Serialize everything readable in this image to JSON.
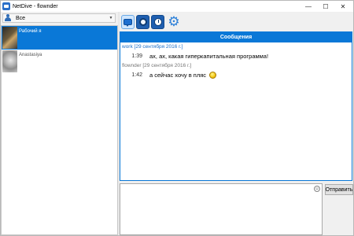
{
  "window": {
    "title": "NetDive - flownder",
    "controls": [
      "—",
      "☐",
      "✕"
    ]
  },
  "contacts": {
    "filter_label": "Все",
    "filter_icon": "users-icon",
    "items": [
      {
        "name": "Рабочий я",
        "selected": true,
        "avatar": "work-avatar"
      },
      {
        "name": "Anastasiya",
        "selected": false,
        "avatar": "anastasiya-avatar"
      }
    ]
  },
  "toolbar": {
    "buttons": [
      "messages-icon",
      "camera-icon",
      "history-icon",
      "settings-gear-icon"
    ]
  },
  "chat": {
    "header": "Сообщения",
    "groups": [
      {
        "sender": "work [29 сентября 2016 г.]",
        "messages": [
          {
            "time": "1:39",
            "text": "ах, ах, какая гиперкапитальная программа!"
          }
        ]
      },
      {
        "sender": "flownder [29 сентября 2016 г.]",
        "messages": [
          {
            "time": "1:42",
            "text": "а сейчас хочу в пляс",
            "emoji": "dancing-smiley"
          }
        ]
      }
    ]
  },
  "compose": {
    "send_label": "Отправить",
    "emoji_icon": "emoji-icon"
  },
  "colors": {
    "accent": "#0a78d7",
    "selected_bg": "#0a78d7"
  }
}
